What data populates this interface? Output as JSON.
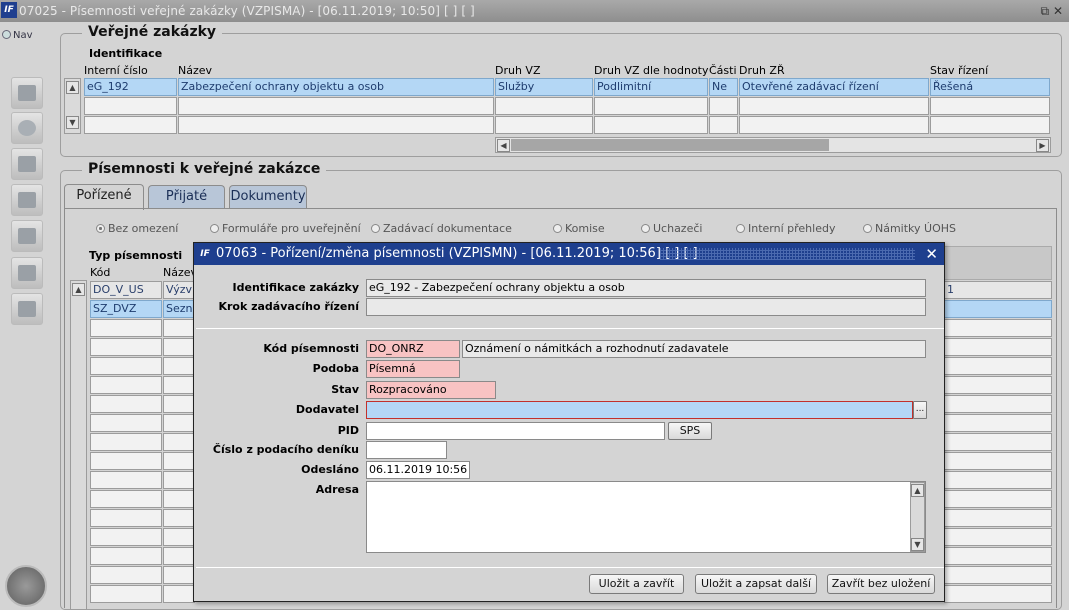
{
  "window": {
    "title": "07025 - Písemnosti veřejné zakázky (VZPISMA) - [06.11.2019; 10:50]  [ ]  [ ]",
    "logo": "IF",
    "restore_icon": "⧉",
    "close_icon": "✕"
  },
  "nav": {
    "label": "Nav"
  },
  "vz_section": {
    "title": "Veřejné zakázky",
    "subtitle": "Identifikace",
    "headers": [
      "Interní číslo",
      "Název",
      "Druh VZ",
      "Druh VZ dle hodnoty",
      "Části",
      "Druh ZŘ",
      "Stav řízení"
    ],
    "row": [
      "eG_192",
      "Zabezpečení ochrany objektu a osob",
      "Služby",
      "Podlimitní",
      "Ne",
      "Otevřené zadávací řízení",
      "Řešená"
    ]
  },
  "pis_section": {
    "title": "Písemnosti k veřejné zakázce",
    "tabs": [
      "Pořízené",
      "Přijaté",
      "Dokumenty"
    ],
    "filters": [
      "Bez omezení",
      "Formuláře pro uveřejnění",
      "Zadávací dokumentace",
      "Komise",
      "Uchazeči",
      "Interní přehledy",
      "Námitky ÚOHS"
    ],
    "typ_label": "Typ písemnosti",
    "col_kod": "Kód",
    "col_nazev": "Název",
    "rows": [
      {
        "kod": "DO_V_US",
        "nazev": "Výzv"
      },
      {
        "kod": "SZ_DVZ",
        "nazev": "Sezna"
      }
    ],
    "right_value": "1"
  },
  "dialog": {
    "title": "07063 - Pořízení/změna písemnosti (VZPISMN) - [06.11.2019; 10:56]  [ ]  [ ]",
    "close": "✕",
    "ident_label": "Identifikace zakázky",
    "ident_value": "eG_192 - Zabezpečení ochrany objektu a osob",
    "krok_label": "Krok zadávacího řízení",
    "krok_value": "",
    "kod_label": "Kód písemnosti",
    "kod_value": "DO_ONRZ",
    "kod_desc": "Oznámení o námitkách a rozhodnutí zadavatele",
    "podoba_label": "Podoba",
    "podoba_value": "Písemná",
    "stav_label": "Stav",
    "stav_value": "Rozpracováno",
    "dodavatel_label": "Dodavatel",
    "dodavatel_value": "",
    "lov_button": "...",
    "pid_label": "PID",
    "pid_value": "",
    "sps_button": "SPS",
    "cislo_label": "Číslo z podacího deníku",
    "cislo_value": "",
    "odeslano_label": "Odesláno",
    "odeslano_value": "06.11.2019 10:56",
    "adresa_label": "Adresa",
    "adresa_value": "",
    "btn_save_close": "Uložit a zavřít",
    "btn_save_next": "Uložit a zapsat další",
    "btn_close_nosave": "Zavřít bez uložení"
  }
}
